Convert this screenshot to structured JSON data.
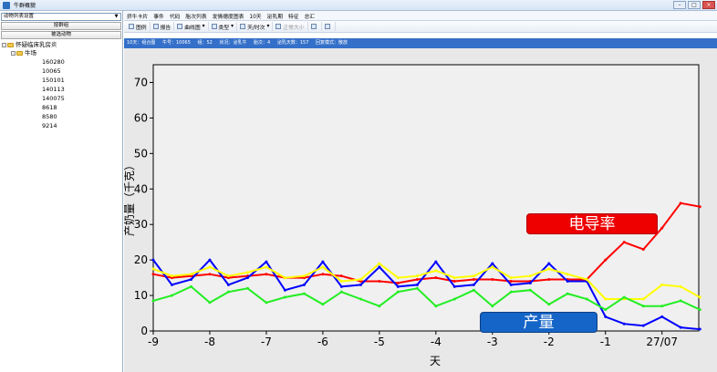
{
  "window": {
    "title": "牛群概貌"
  },
  "left_panel": {
    "select_value": "动物列表设置",
    "buttons": [
      "按群组",
      "被选动物"
    ],
    "tree": {
      "root": "怀疑临床乳房炎",
      "group": "牛场",
      "items": [
        "160280",
        "10065",
        "150101",
        "140113",
        "140075",
        "8618",
        "8580",
        "9214"
      ]
    }
  },
  "menu": [
    "挤牛卡片",
    "事件",
    "代码",
    "胎次列表",
    "发情德度图表",
    "10天",
    "泌乳期",
    "特征",
    "总汇"
  ],
  "toolbar": {
    "legend": "图例",
    "report": "报告",
    "curve": "曲线图",
    "type": "类型",
    "day_hour": "天/时次",
    "normal_size": "正常大小"
  },
  "infobar": [
    "10天：组合图",
    "牛号：10065",
    "组：52",
    "状况：泌乳牛",
    "胎次：4",
    "泌乳天数：157",
    "回复模式：散放"
  ],
  "callouts": {
    "conductivity": "电导率",
    "yield": "产量"
  },
  "colors": {
    "red": "#ff0000",
    "blue": "#0000ff",
    "yellow": "#ffff00",
    "green": "#22ee22"
  },
  "chart_data": {
    "type": "line",
    "xlabel": "天",
    "ylabel": "产奶量（千克）",
    "ylim": [
      0,
      75
    ],
    "yticks": [
      0,
      10,
      20,
      30,
      40,
      50,
      60,
      70
    ],
    "xlim": [
      -9,
      0.65
    ],
    "xticks": [
      {
        "v": -9,
        "label": "-9"
      },
      {
        "v": -8,
        "label": "-8"
      },
      {
        "v": -7,
        "label": "-7"
      },
      {
        "v": -6,
        "label": "-6"
      },
      {
        "v": -5,
        "label": "-5"
      },
      {
        "v": -4,
        "label": "-4"
      },
      {
        "v": -3,
        "label": "-3"
      },
      {
        "v": -2,
        "label": "-2"
      },
      {
        "v": -1,
        "label": "-1"
      },
      {
        "v": 0,
        "label": "27/07"
      }
    ],
    "x": [
      -9,
      -8.67,
      -8.33,
      -8,
      -7.67,
      -7.33,
      -7,
      -6.67,
      -6.33,
      -6,
      -5.67,
      -5.33,
      -5,
      -4.67,
      -4.33,
      -4,
      -3.67,
      -3.33,
      -3,
      -2.67,
      -2.33,
      -2,
      -1.67,
      -1.33,
      -1,
      -0.67,
      -0.33,
      0,
      0.33,
      0.67
    ],
    "series": [
      {
        "color": "red",
        "values": [
          16,
          15,
          15.5,
          16,
          15,
          15.5,
          16,
          15,
          15,
          16,
          15.5,
          14,
          14,
          13.5,
          14.5,
          15,
          14,
          14.5,
          14.5,
          14,
          14,
          14.5,
          14.5,
          14.5,
          20,
          25,
          23,
          29,
          36,
          35
        ]
      },
      {
        "color": "blue",
        "values": [
          20,
          13,
          14.5,
          20,
          13,
          15,
          19.5,
          11.5,
          13,
          19.5,
          12.5,
          13,
          18,
          12.5,
          13,
          19.5,
          12.5,
          13,
          19,
          13,
          13.5,
          19,
          14,
          14,
          4,
          2,
          1.5,
          4,
          1,
          0.5
        ]
      },
      {
        "color": "yellow",
        "values": [
          17.5,
          15.5,
          16,
          18,
          15.5,
          16.5,
          18,
          15,
          15.5,
          18,
          14,
          14.5,
          19,
          15,
          15.5,
          17,
          15,
          15.5,
          18,
          15,
          15.5,
          17.5,
          16,
          14.5,
          9,
          9,
          9,
          13,
          12.5,
          9.5
        ]
      },
      {
        "color": "green",
        "values": [
          8.5,
          10,
          12.5,
          8,
          11,
          12,
          8,
          9.5,
          10.5,
          7.5,
          11,
          9,
          7,
          11,
          12,
          7,
          9,
          11.5,
          7,
          11,
          11.5,
          7.5,
          10.5,
          9,
          6,
          9.5,
          7,
          7,
          8.5,
          6
        ]
      }
    ]
  }
}
